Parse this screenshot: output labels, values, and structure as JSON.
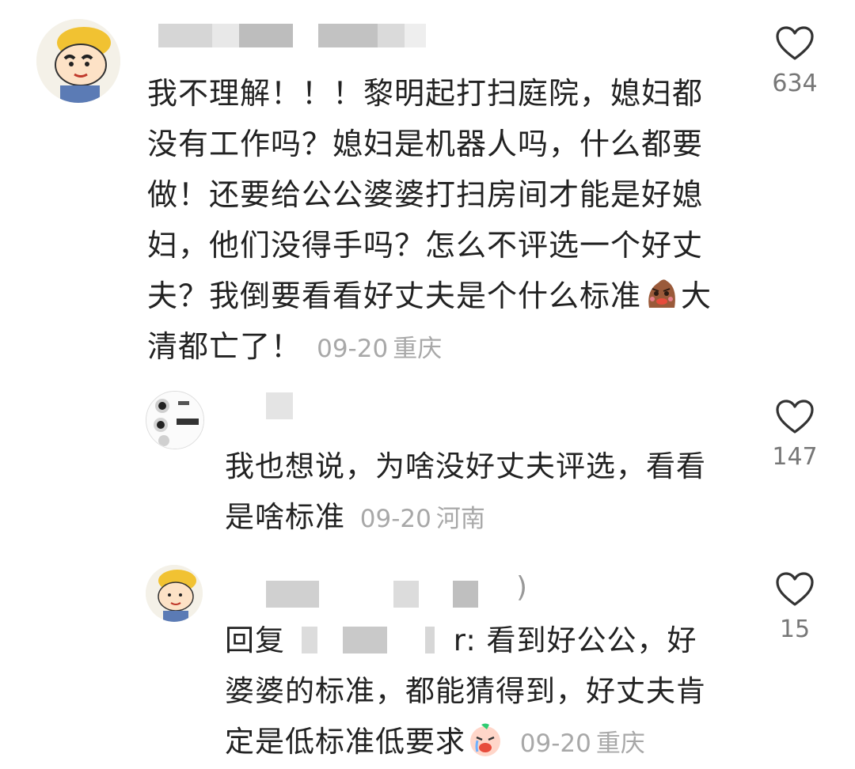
{
  "comments": [
    {
      "text_before_emoji": "我不理解！！！黎明起打扫庭院，媳妇都没有工作吗？媳妇是机器人吗，什么都要做！还要给公公婆婆打扫房间才能是好媳妇，他们没得手吗？怎么不评选一个好丈夫？我倒要看看好丈夫是个什么标准",
      "emoji": "grimace-emoji",
      "text_after_emoji": "大清都亡了！",
      "date": "09-20",
      "location": "重庆",
      "likes": "634"
    },
    {
      "text": "我也想说，为啥没好丈夫评选，看看是啥标准",
      "date": "09-20",
      "location": "河南",
      "likes": "147"
    },
    {
      "reply_prefix": "回复",
      "reply_suffix": "r: 看到好公公，好婆婆的标准，都能猜得到，好丈夫肯定是低标准低要求",
      "emoji": "crying-emoji",
      "date": "09-20",
      "location": "重庆",
      "likes": "15"
    }
  ],
  "colors": {
    "text": "#222222",
    "meta": "#a8a8a8",
    "like_count": "#777777",
    "heart_outline": "#333333"
  }
}
